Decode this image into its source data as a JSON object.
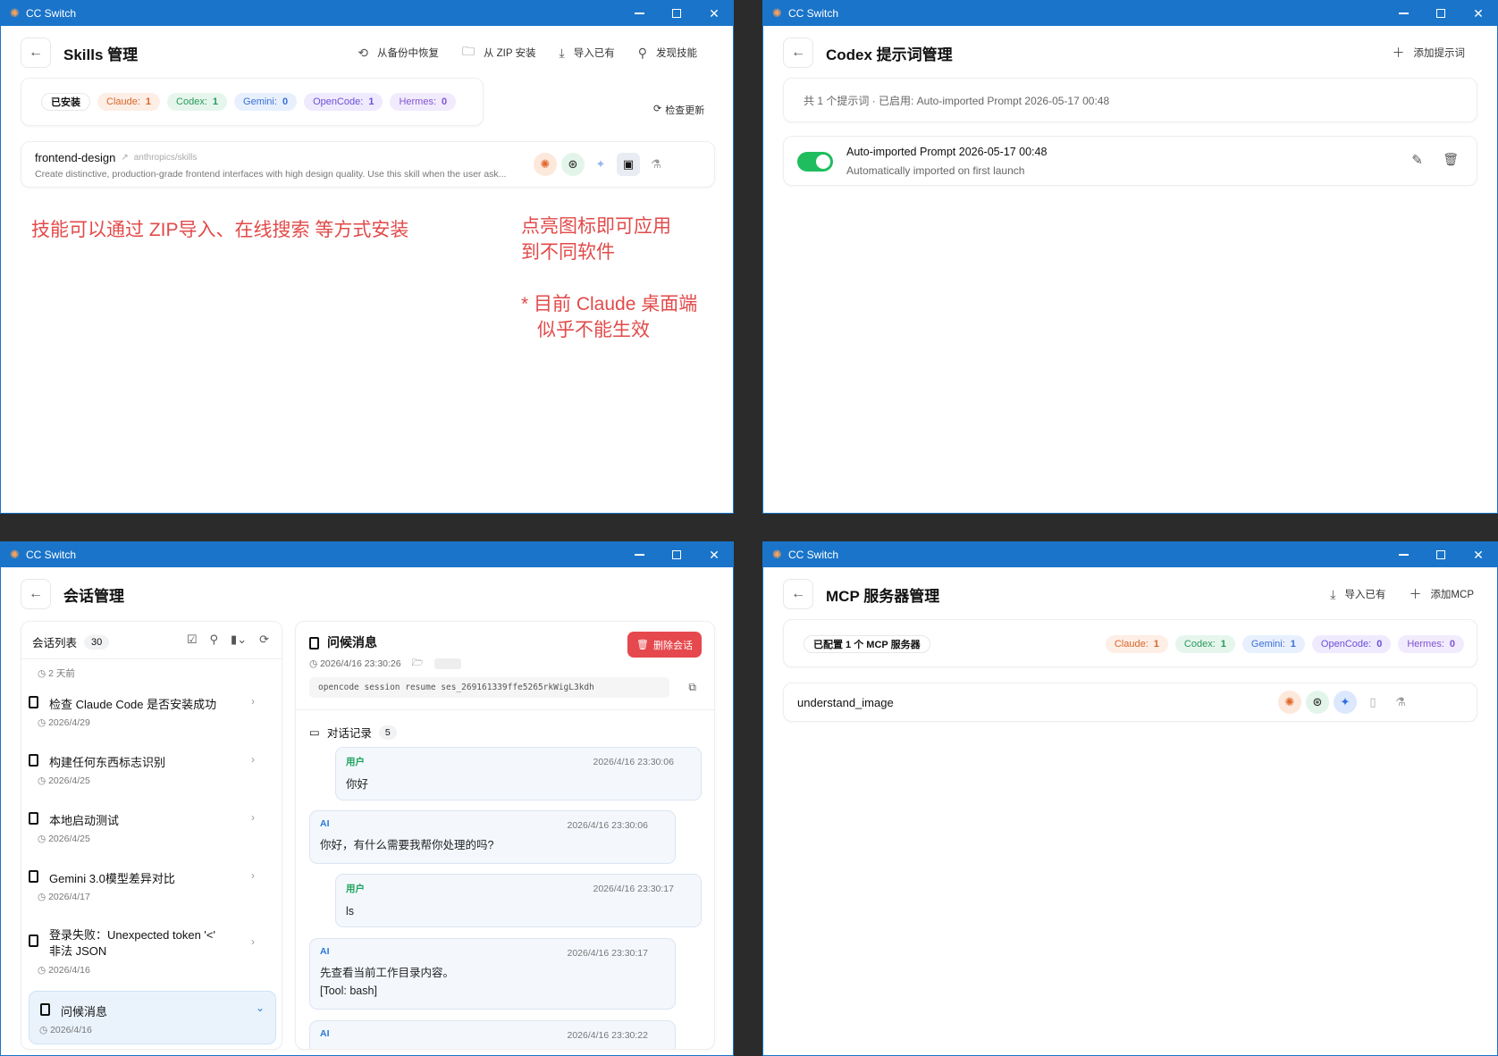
{
  "app_title": "CC Switch",
  "skills": {
    "title": "Skills 管理",
    "actions": [
      "从备份中恢复",
      "从 ZIP 安装",
      "导入已有",
      "发现技能"
    ],
    "installed_label": "已安装",
    "counts": [
      {
        "name": "Claude:",
        "value": "1"
      },
      {
        "name": "Codex:",
        "value": "1"
      },
      {
        "name": "Gemini:",
        "value": "0"
      },
      {
        "name": "OpenCode:",
        "value": "1"
      },
      {
        "name": "Hermes:",
        "value": "0"
      }
    ],
    "check_updates": "检查更新",
    "skill_name": "frontend-design",
    "skill_repo": "anthropics/skills",
    "skill_desc": "Create distinctive, production-grade frontend interfaces with high design quality. Use this skill when the user ask...",
    "note1": "技能可以通过 ZIP导入、在线搜索 等方式安装",
    "note2a": "点亮图标即可应用",
    "note2b": "到不同软件",
    "note3a": "* 目前 Claude 桌面端",
    "note3b": "似乎不能生效"
  },
  "prompts": {
    "title": "Codex 提示词管理",
    "add_label": "添加提示词",
    "summary": "共 1 个提示词 · 已启用: Auto-imported Prompt 2026-05-17 00:48",
    "item_title": "Auto-imported Prompt 2026-05-17 00:48",
    "item_desc": "Automatically imported on first launch"
  },
  "sessions": {
    "title": "会话管理",
    "list_label": "会话列表",
    "list_count": "30",
    "first_date": "2 天前",
    "items": [
      {
        "title": "检查 Claude Code 是否安装成功",
        "date": "2026/4/29"
      },
      {
        "title": "构建任何东西标志识别",
        "date": "2026/4/25"
      },
      {
        "title": "本地启动测试",
        "date": "2026/4/25"
      },
      {
        "title": "Gemini 3.0模型差异对比",
        "date": "2026/4/17"
      },
      {
        "title": "登录失败：Unexpected token '<' 非法 JSON",
        "date": "2026/4/16"
      },
      {
        "title": "问候消息",
        "date": "2026/4/16"
      }
    ],
    "detail_title": "问候消息",
    "detail_time": "2026/4/16 23:30:26",
    "delete_label": "删除会话",
    "command": "opencode session resume ses_269161339ffe5265rkWigL3kdh",
    "history_label": "对话记录",
    "history_count": "5",
    "messages": [
      {
        "role": "用户",
        "time": "2026/4/16 23:30:06",
        "text": "你好"
      },
      {
        "role": "AI",
        "time": "2026/4/16 23:30:06",
        "text": "你好，有什么需要我帮你处理的吗?"
      },
      {
        "role": "用户",
        "time": "2026/4/16 23:30:17",
        "text": "ls"
      },
      {
        "role": "AI",
        "time": "2026/4/16 23:30:17",
        "text": "先查看当前工作目录内容。",
        "text2": "[Tool: bash]"
      },
      {
        "role": "AI",
        "time": "2026/4/16 23:30:22",
        "text": ""
      }
    ]
  },
  "mcp": {
    "title": "MCP 服务器管理",
    "import_label": "导入已有",
    "add_label": "添加MCP",
    "configured": "已配置 1 个 MCP 服务器",
    "counts": [
      {
        "name": "Claude:",
        "value": "1"
      },
      {
        "name": "Codex:",
        "value": "1"
      },
      {
        "name": "Gemini:",
        "value": "1"
      },
      {
        "name": "OpenCode:",
        "value": "0"
      },
      {
        "name": "Hermes:",
        "value": "0"
      }
    ],
    "server_name": "understand_image"
  }
}
